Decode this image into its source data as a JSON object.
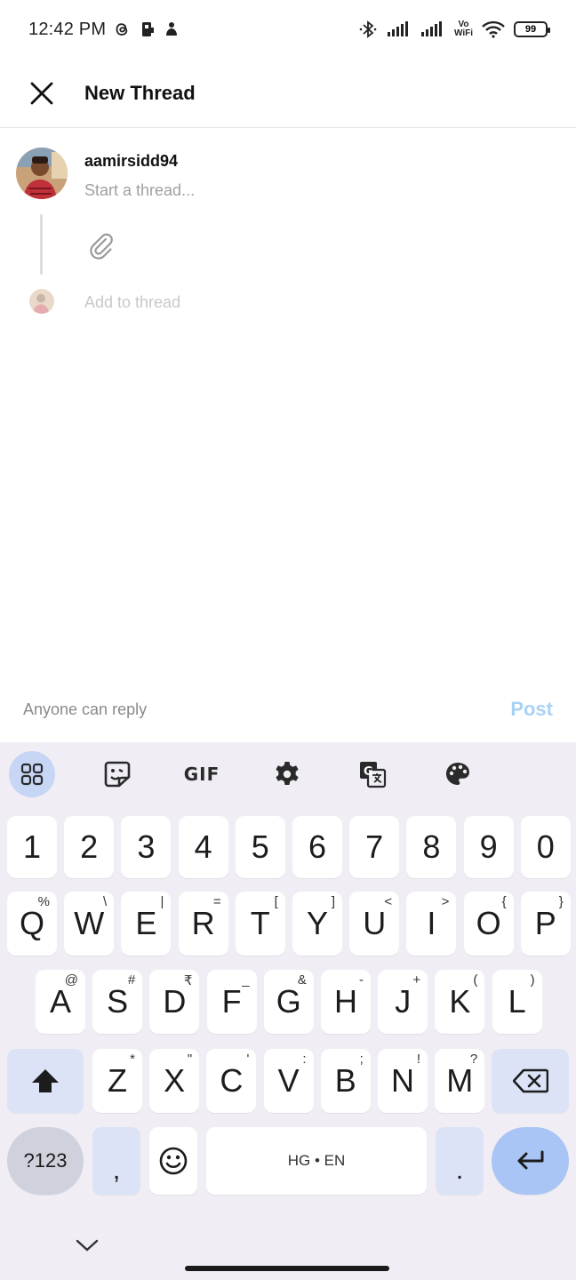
{
  "status_bar": {
    "time": "12:42 PM",
    "left_icons": [
      "threads-icon",
      "sim-card-icon",
      "notification-icon"
    ],
    "right_icons": [
      "bluetooth-icon",
      "signal-icon",
      "signal-icon"
    ],
    "vowifi_line1": "Vo",
    "vowifi_line2": "WiFi",
    "battery": "99"
  },
  "header": {
    "title": "New Thread"
  },
  "composer": {
    "username": "aamirsidd94",
    "placeholder": "Start a thread...",
    "add_to_thread": "Add to thread"
  },
  "footer": {
    "reply_setting": "Anyone can reply",
    "post_label": "Post",
    "post_color": "#a8d2f5"
  },
  "keyboard": {
    "toolbar": [
      "apps-grid-icon",
      "sticker-icon",
      "gif-icon",
      "settings-icon",
      "translate-icon",
      "palette-icon"
    ],
    "gif_label": "GIF",
    "number_row": [
      "1",
      "2",
      "3",
      "4",
      "5",
      "6",
      "7",
      "8",
      "9",
      "0"
    ],
    "row1": [
      {
        "key": "Q",
        "hint": "%"
      },
      {
        "key": "W",
        "hint": "\\"
      },
      {
        "key": "E",
        "hint": "|"
      },
      {
        "key": "R",
        "hint": "="
      },
      {
        "key": "T",
        "hint": "["
      },
      {
        "key": "Y",
        "hint": "]"
      },
      {
        "key": "U",
        "hint": "<"
      },
      {
        "key": "I",
        "hint": ">"
      },
      {
        "key": "O",
        "hint": "{"
      },
      {
        "key": "P",
        "hint": "}"
      }
    ],
    "row2": [
      {
        "key": "A",
        "hint": "@"
      },
      {
        "key": "S",
        "hint": "#"
      },
      {
        "key": "D",
        "hint": "₹"
      },
      {
        "key": "F",
        "hint": "_"
      },
      {
        "key": "G",
        "hint": "&"
      },
      {
        "key": "H",
        "hint": "-"
      },
      {
        "key": "J",
        "hint": "+"
      },
      {
        "key": "K",
        "hint": "("
      },
      {
        "key": "L",
        "hint": ")"
      }
    ],
    "row3": [
      {
        "key": "Z",
        "hint": "*"
      },
      {
        "key": "X",
        "hint": "\""
      },
      {
        "key": "C",
        "hint": "'"
      },
      {
        "key": "V",
        "hint": ":"
      },
      {
        "key": "B",
        "hint": ";"
      },
      {
        "key": "N",
        "hint": "!"
      },
      {
        "key": "M",
        "hint": "?"
      }
    ],
    "symbols_label": "?123",
    "comma": ",",
    "space_label": "HG • EN",
    "period": ".",
    "accent_color": "#a9c5f5"
  }
}
